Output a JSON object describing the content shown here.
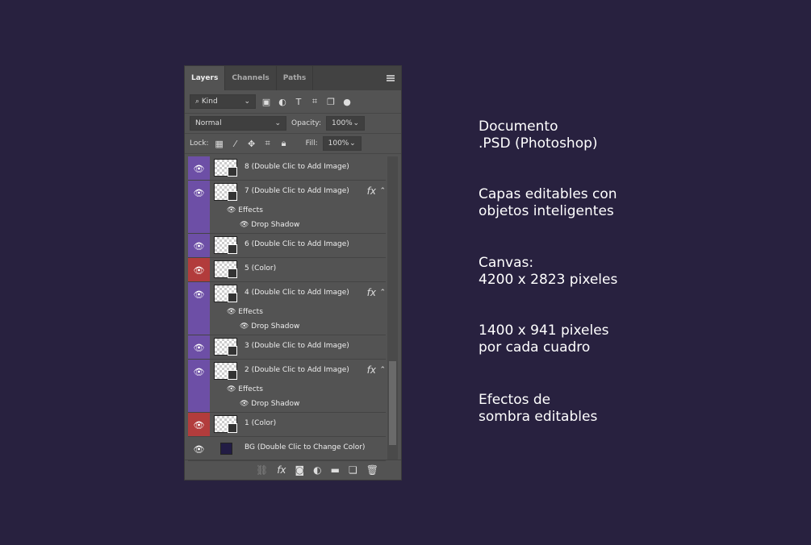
{
  "panel": {
    "tabs": [
      "Layers",
      "Channels",
      "Paths"
    ],
    "filter": {
      "label": "Kind"
    },
    "blend_mode": "Normal",
    "opacity_label": "Opacity:",
    "opacity": "100%",
    "lock_label": "Lock:",
    "fill_label": "Fill:",
    "fill": "100%",
    "layers": [
      {
        "name": "8 (Double Clic to Add Image)",
        "tag": "purple"
      },
      {
        "name": "7 (Double Clic to Add Image)",
        "tag": "purple",
        "fx": "fx",
        "effects": "Effects",
        "effect": "Drop Shadow"
      },
      {
        "name": "6 (Double Clic to Add Image)",
        "tag": "purple"
      },
      {
        "name": "5 (Color)",
        "tag": "red"
      },
      {
        "name": "4  (Double Clic to Add Image)",
        "tag": "purple",
        "fx": "fx",
        "effects": "Effects",
        "effect": "Drop Shadow"
      },
      {
        "name": "3  (Double Clic to Add Image)",
        "tag": "purple"
      },
      {
        "name": "2  (Double Clic to Add Image)",
        "tag": "purple",
        "fx": "fx",
        "effects": "Effects",
        "effect": "Drop Shadow"
      },
      {
        "name": "1 (Color)",
        "tag": "red"
      },
      {
        "name": "BG (Double Clic to Change Color)",
        "tag": "none",
        "swatch": "#221c44"
      }
    ],
    "footer_fx": "fx"
  },
  "info": [
    [
      "Documento",
      ".PSD (Photoshop)"
    ],
    [
      "Capas editables con",
      "objetos inteligentes"
    ],
    [
      "Canvas:",
      "4200 x 2823 pixeles"
    ],
    [
      "1400 x 941 pixeles",
      "por cada cuadro"
    ],
    [
      "Efectos de",
      "sombra editables"
    ]
  ]
}
